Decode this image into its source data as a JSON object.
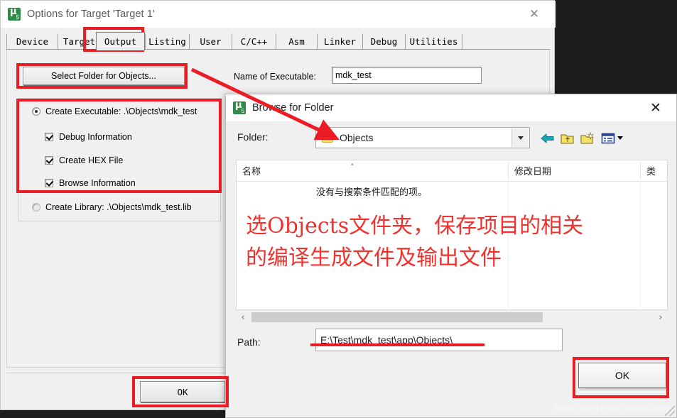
{
  "options_dialog": {
    "icon": "keil-uvision5-icon",
    "title": "Options for Target 'Target 1'",
    "close_icon": "close-icon",
    "tabs": [
      {
        "label": "Device",
        "selected": false
      },
      {
        "label": "Target",
        "selected": false
      },
      {
        "label": "Output",
        "selected": true
      },
      {
        "label": "Listing",
        "selected": false
      },
      {
        "label": "User",
        "selected": false
      },
      {
        "label": "C/C++",
        "selected": false
      },
      {
        "label": "Asm",
        "selected": false
      },
      {
        "label": "Linker",
        "selected": false
      },
      {
        "label": "Debug",
        "selected": false
      },
      {
        "label": "Utilities",
        "selected": false
      }
    ],
    "select_folder_button": "Select Folder for Objects...",
    "executable_label": "Name of Executable:",
    "executable_value": "mdk_test",
    "create_executable": {
      "label": "Create Executable:  .\\Objects\\mdk_test",
      "selected": true
    },
    "checkboxes": [
      {
        "label": "Debug Information",
        "checked": true
      },
      {
        "label": "Create HEX File",
        "checked": true
      },
      {
        "label": "Browse Information",
        "checked": true
      }
    ],
    "create_library": {
      "label": "Create Library:  .\\Objects\\mdk_test.lib",
      "selected": false
    },
    "ok_button": "OK"
  },
  "browse_dialog": {
    "icon": "keil-uvision5-icon",
    "title": "Browse for Folder",
    "close_icon": "close-icon",
    "folder_label": "Folder:",
    "folder_value": "Objects",
    "folder_icon": "folder-icon",
    "dropdown_icon": "chevron-down-icon",
    "toolbar": [
      {
        "name": "back-arrow-icon"
      },
      {
        "name": "up-one-level-icon"
      },
      {
        "name": "new-folder-icon"
      },
      {
        "name": "view-mode-icon"
      }
    ],
    "columns": [
      {
        "label": "名称"
      },
      {
        "label": "修改日期"
      },
      {
        "label": "类"
      }
    ],
    "sort_caret": "˄",
    "empty_message": "没有与搜索条件匹配的项。",
    "hscroll": {
      "left_arrow": "‹",
      "right_arrow": "›"
    },
    "path_label": "Path:",
    "path_value": "E:\\Test\\mdk_test\\app\\Objects\\",
    "ok_button": "OK"
  },
  "annotation": {
    "note_text": "选Objects文件夹，保存项目的相关\n的编译生成文件及输出文件",
    "note_color": "#f0322f",
    "box_color": "#ec1c24"
  },
  "watermark": {
    "text": "https://blog.csdn.net/willOkay"
  }
}
